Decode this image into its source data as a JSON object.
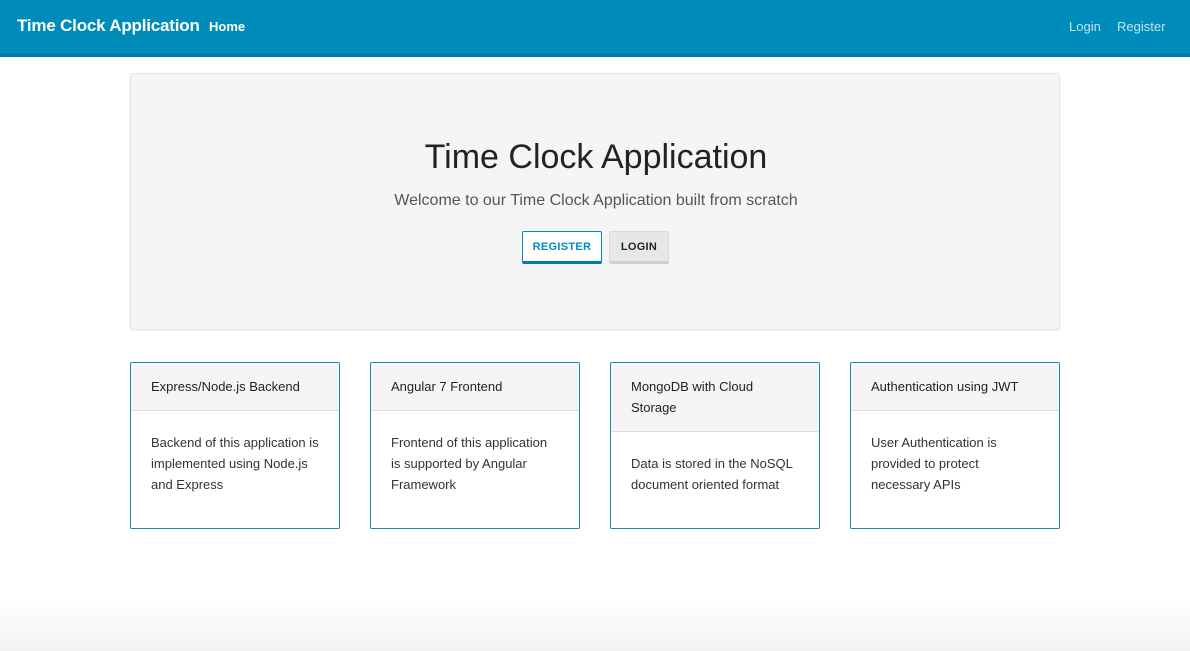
{
  "navbar": {
    "brand": "Time Clock Application",
    "home": "Home",
    "login": "Login",
    "register": "Register",
    "color": "#008cba"
  },
  "jumbotron": {
    "title": "Time Clock Application",
    "subtitle": "Welcome to our Time Clock Application built from scratch",
    "register_button": "REGISTER",
    "login_button": "LOGIN"
  },
  "cards": [
    {
      "header": "Express/Node.js Backend",
      "body": "Backend of this application is implemented using Node.js and Express"
    },
    {
      "header": "Angular 7 Frontend",
      "body": "Frontend of this application is supported by Angular Framework"
    },
    {
      "header": "MongoDB with Cloud Storage",
      "body": "Data is stored in the NoSQL document oriented format"
    },
    {
      "header": "Authentication using JWT",
      "body": "User Authentication is provided to protect necessary APIs"
    }
  ]
}
